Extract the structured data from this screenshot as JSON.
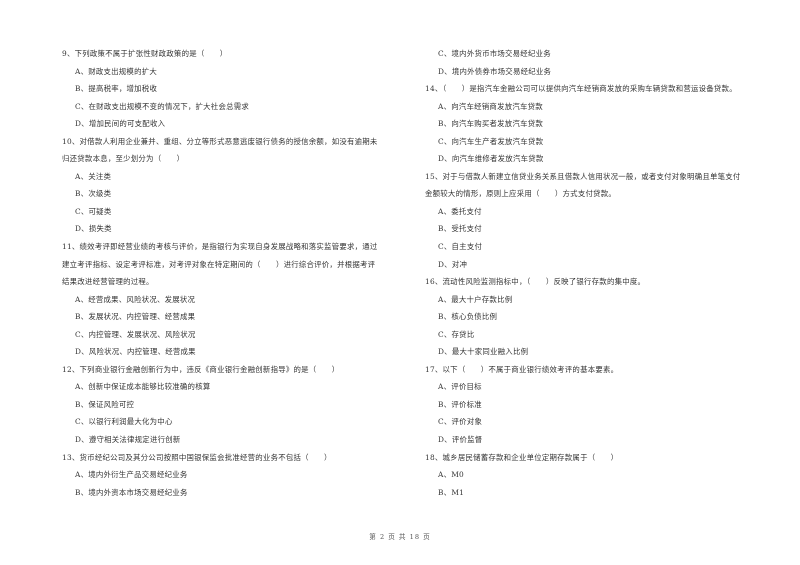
{
  "page": {
    "footer": "第 2 页 共 18 页"
  },
  "left_column": [
    {
      "type": "q",
      "text": "9、下列政策不属于扩张性财政政策的是（　　）"
    },
    {
      "type": "opt",
      "text": "A、财政支出规模的扩大"
    },
    {
      "type": "opt",
      "text": "B、提高税率，增加税收"
    },
    {
      "type": "opt",
      "text": "C、在财政支出规模不变的情况下，扩大社会总需求"
    },
    {
      "type": "opt",
      "text": "D、增加民间的可支配收入"
    },
    {
      "type": "q",
      "text": "10、对借款人利用企业兼并、重组、分立等形式恶意逃废银行债务的授信余额，如没有逾期未"
    },
    {
      "type": "q",
      "text": "归还贷款本息，至少划分为（　　）"
    },
    {
      "type": "opt",
      "text": "A、关注类"
    },
    {
      "type": "opt",
      "text": "B、次级类"
    },
    {
      "type": "opt",
      "text": "C、可疑类"
    },
    {
      "type": "opt",
      "text": "D、损失类"
    },
    {
      "type": "q",
      "text": "11、绩效考评即经营业绩的考核与评价，是指银行为实现自身发展战略和落实监管要求，通过"
    },
    {
      "type": "q",
      "text": "建立考评指标、设定考评标准，对考评对象在特定期间的（　　）进行综合评价，并根据考评"
    },
    {
      "type": "q",
      "text": "结果改进经营管理的过程。"
    },
    {
      "type": "opt",
      "text": "A、经营成果、风险状况、发展状况"
    },
    {
      "type": "opt",
      "text": "B、发展状况、内控管理、经营成果"
    },
    {
      "type": "opt",
      "text": "C、内控管理、发展状况、风险状况"
    },
    {
      "type": "opt",
      "text": "D、风险状况、内控管理、经营成果"
    },
    {
      "type": "q",
      "text": "12、下列商业银行金融创新行为中，违反《商业银行金融创新指导》的是（　　）"
    },
    {
      "type": "opt",
      "text": "A、创新中保证成本能够比较准确的核算"
    },
    {
      "type": "opt",
      "text": "B、保证风险可控"
    },
    {
      "type": "opt",
      "text": "C、以银行利润最大化为中心"
    },
    {
      "type": "opt",
      "text": "D、遵守相关法律规定进行创新"
    },
    {
      "type": "q",
      "text": "13、货币经纪公司及其分公司按照中国银保监会批准经营的业务不包括（　　）"
    },
    {
      "type": "opt",
      "text": "A、境内外衍生产品交易经纪业务"
    },
    {
      "type": "opt",
      "text": "B、境内外资本市场交易经纪业务"
    }
  ],
  "right_column": [
    {
      "type": "opt",
      "text": "C、境内外货币市场交易经纪业务"
    },
    {
      "type": "opt",
      "text": "D、境内外债券市场交易经纪业务"
    },
    {
      "type": "q",
      "text": "14、（　　）是指汽车金融公司可以提供向汽车经销商发放的采购车辆贷款和营运设备贷款。"
    },
    {
      "type": "opt",
      "text": "A、向汽车经销商发放汽车贷款"
    },
    {
      "type": "opt",
      "text": "B、向汽车购买者发放汽车贷款"
    },
    {
      "type": "opt",
      "text": "C、向汽车生产者发放汽车贷款"
    },
    {
      "type": "opt",
      "text": "D、向汽车维修者发放汽车贷款"
    },
    {
      "type": "q",
      "text": "15、对于与借款人新建立信贷业务关系且借款人信用状况一般，或者支付对象明确且单笔支付"
    },
    {
      "type": "q",
      "text": "金额较大的情形，原则上应采用（　　）方式支付贷款。"
    },
    {
      "type": "opt",
      "text": "A、委托支付"
    },
    {
      "type": "opt",
      "text": "B、受托支付"
    },
    {
      "type": "opt",
      "text": "C、自主支付"
    },
    {
      "type": "opt",
      "text": "D、对冲"
    },
    {
      "type": "q",
      "text": "16、流动性风险监测指标中，（　　）反映了银行存款的集中度。"
    },
    {
      "type": "opt",
      "text": "A、最大十户存款比例"
    },
    {
      "type": "opt",
      "text": "B、核心负债比例"
    },
    {
      "type": "opt",
      "text": "C、存贷比"
    },
    {
      "type": "opt",
      "text": "D、最大十家同业融入比例"
    },
    {
      "type": "q",
      "text": "17、以下（　　）不属于商业银行绩效考评的基本要素。"
    },
    {
      "type": "opt",
      "text": "A、评价目标"
    },
    {
      "type": "opt",
      "text": "B、评价标准"
    },
    {
      "type": "opt",
      "text": "C、评价对象"
    },
    {
      "type": "opt",
      "text": "D、评价监督"
    },
    {
      "type": "q",
      "text": "18、城乡居民储蓄存款和企业单位定期存款属于（　　）"
    },
    {
      "type": "opt",
      "text": "A、M0"
    },
    {
      "type": "opt",
      "text": "B、M1"
    }
  ]
}
